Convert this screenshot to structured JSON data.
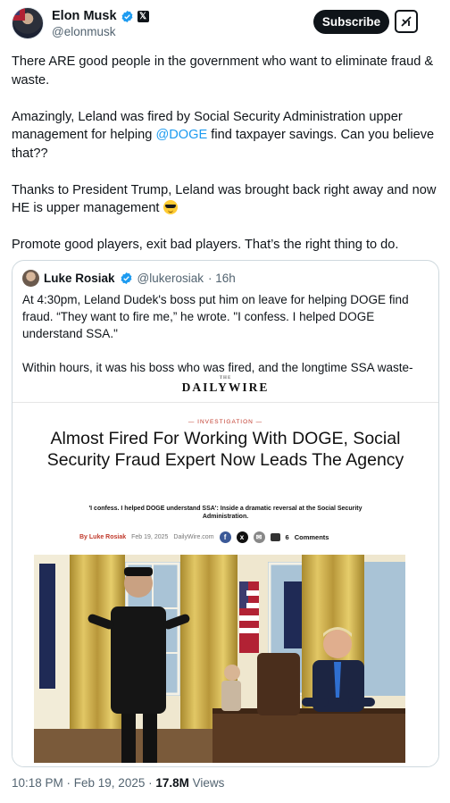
{
  "author": {
    "display_name": "Elon Musk",
    "handle": "@elonmusk",
    "verified_icon": "verified-badge-icon",
    "affiliation_icon": "x-logo-icon"
  },
  "actions": {
    "subscribe_label": "Subscribe",
    "grok_icon": "grok-icon"
  },
  "tweet": {
    "p1": "There ARE good people in the government who want to eliminate fraud & waste.",
    "p2_before": "Amazingly, Leland was fired by Social Security Administration upper management for helping ",
    "p2_mention": "@DOGE",
    "p2_after": " find taxpayer savings. Can you believe that??",
    "p3": "Thanks to President Trump, Leland was brought back right away and now HE is upper management ",
    "p3_emoji": "smiling-face-with-sunglasses-icon",
    "p4": "Promote good players, exit bad players. That’s the right thing to do."
  },
  "quote": {
    "name": "Luke Rosiak",
    "handle": "@lukerosiak",
    "time": "· 16h",
    "verified_icon": "verified-badge-icon",
    "p1": "At 4:30pm, Leland Dudek's boss put him on leave for helping DOGE find fraud. “They want to fire me,” he wrote. \"I confess. I helped DOGE understand SSA.\"",
    "p2": "Within hours, it was his boss who was fired, and the longtime SSA waste-watcher was elevated to lead the whole agency."
  },
  "article": {
    "logo_small": "THE",
    "logo": "DAILYWIRE",
    "kicker": "— INVESTIGATION —",
    "headline": "Almost Fired For Working With DOGE, Social Security Fraud Expert Now Leads The Agency",
    "subhead": "'I confess. I helped DOGE understand SSA': Inside a dramatic reversal at the Social Security Administration.",
    "byline_by": "By  Luke Rosiak",
    "byline_date": "Feb 19, 2025",
    "byline_site": "DailyWire.com",
    "comments_count": "6",
    "comments_label": "Comments"
  },
  "footer": {
    "time": "10:18 PM · Feb 19, 2025 · ",
    "views_count": "17.8M",
    "views_label": " Views"
  }
}
